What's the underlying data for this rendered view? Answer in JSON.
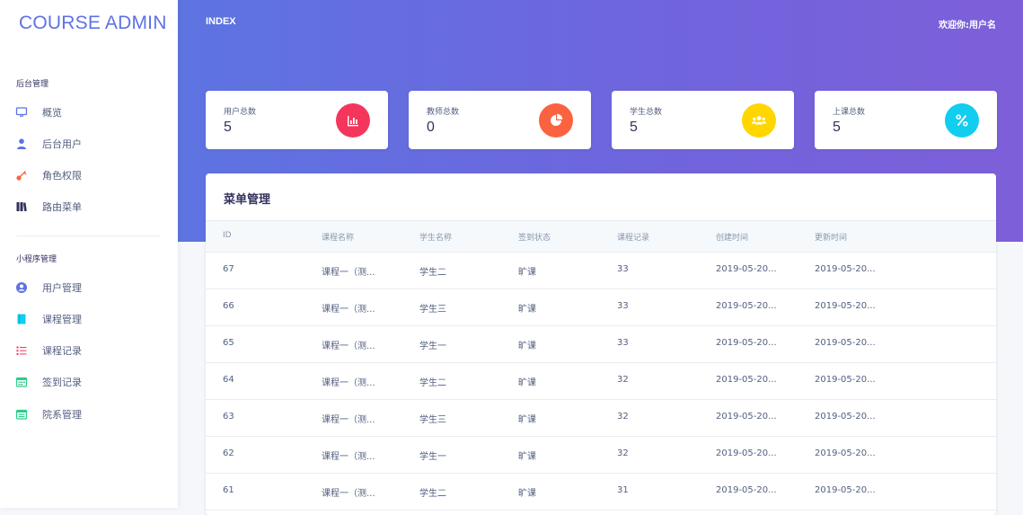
{
  "brand": "COURSE ADMIN",
  "header": {
    "title": "INDEX",
    "welcome": "欢迎你:用户名"
  },
  "sidebar": {
    "section1": "后台管理",
    "section2": "小程序管理",
    "items": [
      {
        "label": "概览",
        "icon": "monitor-icon",
        "color": "#5e72e4"
      },
      {
        "label": "后台用户",
        "icon": "user-icon",
        "color": "#5e72e4"
      },
      {
        "label": "角色权限",
        "icon": "key-icon",
        "color": "#fb6340"
      },
      {
        "label": "路由菜单",
        "icon": "books-icon",
        "color": "#32325d"
      },
      {
        "label": "用户管理",
        "icon": "user-circle-icon",
        "color": "#5e72e4"
      },
      {
        "label": "课程管理",
        "icon": "book-icon",
        "color": "#11cdef"
      },
      {
        "label": "课程记录",
        "icon": "list-icon",
        "color": "#f5365c"
      },
      {
        "label": "签到记录",
        "icon": "calendar-icon",
        "color": "#2dce89"
      },
      {
        "label": "院系管理",
        "icon": "calendar-grid-icon",
        "color": "#2dce89"
      }
    ]
  },
  "stats": [
    {
      "label": "用户总数",
      "value": "5",
      "icon": "bar-chart-icon",
      "color": "#f5365c"
    },
    {
      "label": "教师总数",
      "value": "0",
      "icon": "pie-chart-icon",
      "color": "#fb6340"
    },
    {
      "label": "学生总数",
      "value": "5",
      "icon": "users-icon",
      "color": "#ffd600"
    },
    {
      "label": "上课总数",
      "value": "5",
      "icon": "percent-icon",
      "color": "#11cdef"
    }
  ],
  "table": {
    "title": "菜单管理",
    "columns": [
      "ID",
      "课程名称",
      "学生名称",
      "签到状态",
      "课程记录",
      "创建时间",
      "更新时间"
    ],
    "rows": [
      [
        "67",
        "课程一（测...",
        "学生二",
        "旷课",
        "33",
        "2019-05-20...",
        "2019-05-20..."
      ],
      [
        "66",
        "课程一（测...",
        "学生三",
        "旷课",
        "33",
        "2019-05-20...",
        "2019-05-20..."
      ],
      [
        "65",
        "课程一（测...",
        "学生一",
        "旷课",
        "33",
        "2019-05-20...",
        "2019-05-20..."
      ],
      [
        "64",
        "课程一（测...",
        "学生二",
        "旷课",
        "32",
        "2019-05-20...",
        "2019-05-20..."
      ],
      [
        "63",
        "课程一（测...",
        "学生三",
        "旷课",
        "32",
        "2019-05-20...",
        "2019-05-20..."
      ],
      [
        "62",
        "课程一（测...",
        "学生一",
        "旷课",
        "32",
        "2019-05-20...",
        "2019-05-20..."
      ],
      [
        "61",
        "课程一（测...",
        "学生二",
        "旷课",
        "31",
        "2019-05-20...",
        "2019-05-20..."
      ]
    ]
  }
}
